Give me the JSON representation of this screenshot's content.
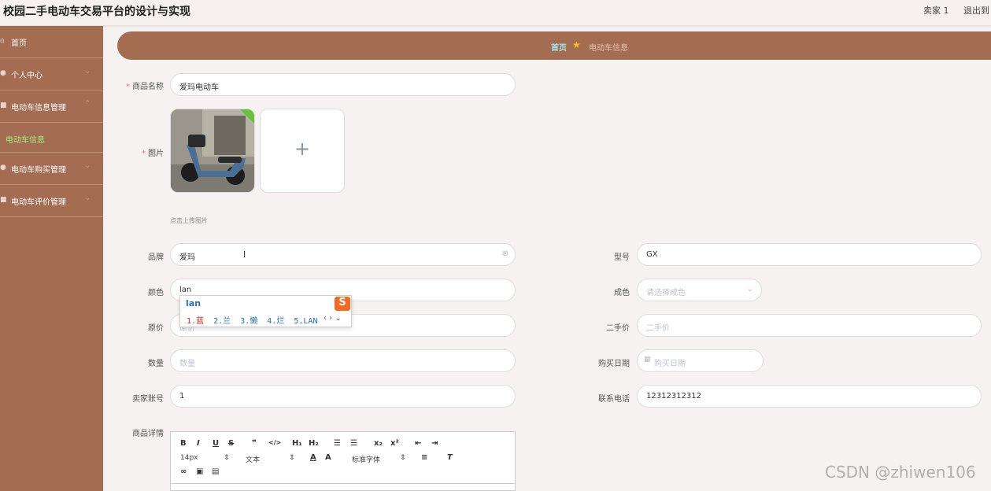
{
  "header": {
    "title": "校园二手电动车交易平台的设计与实现",
    "user": "卖家 1",
    "logout": "退出到"
  },
  "sidebar": {
    "items": [
      {
        "label": "首页",
        "icon": "home-icon"
      },
      {
        "label": "个人中心",
        "icon": "user-icon"
      },
      {
        "label": "电动车信息管理",
        "icon": "folder-icon"
      },
      {
        "label": "电动车购买管理",
        "icon": "cart-icon"
      },
      {
        "label": "电动车评价管理",
        "icon": "comment-icon"
      }
    ],
    "sub_active": "电动车信息"
  },
  "breadcrumb": {
    "home": "首页",
    "current": "电动车信息"
  },
  "form": {
    "name_label": "商品名称",
    "name_value": "爱玛电动车",
    "image_label": "图片",
    "upload_tip": "点击上传图片",
    "brand_label": "品牌",
    "brand_value": "爱玛",
    "model_label": "型号",
    "model_value": "GX",
    "color_label": "颜色",
    "color_value": "lan",
    "condition_label": "成色",
    "condition_placeholder": "请选择成色",
    "orig_price_label": "原价",
    "orig_price_placeholder": "原价",
    "second_price_label": "二手价",
    "second_price_placeholder": "二手价",
    "quantity_label": "数量",
    "quantity_placeholder": "数量",
    "purchase_date_label": "购买日期",
    "purchase_date_placeholder": "购买日期",
    "seller_account_label": "卖家账号",
    "seller_account_value": "1",
    "phone_label": "联系电话",
    "phone_value": "12312312312",
    "detail_label": "商品详情"
  },
  "ime": {
    "composition": "lan",
    "candidates": [
      "1.蓝",
      "2.兰",
      "3.懒",
      "4.烂",
      "5.LAN"
    ]
  },
  "editor": {
    "font_size": "14px",
    "text_style": "文本",
    "font_family": "标准字体"
  },
  "watermark": "CSDN @zhiwen106",
  "colors": {
    "sidebar": "#a46d52",
    "active": "#9cf07e",
    "background": "#f7f2f2"
  }
}
